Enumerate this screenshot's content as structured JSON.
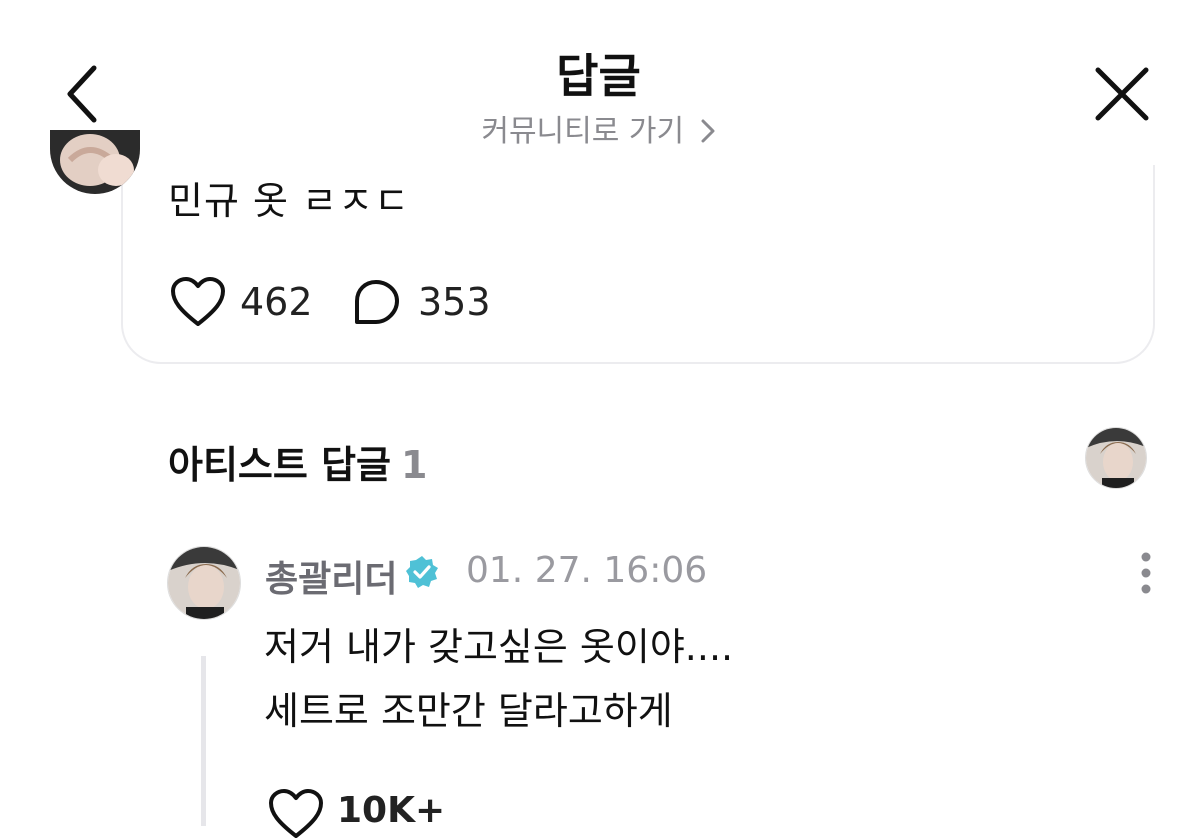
{
  "header": {
    "title": "답글",
    "community_link": "커뮤니티로 가기"
  },
  "post": {
    "text": "민규 옷 ㄹㅈㄷ",
    "likes": "462",
    "comments": "353"
  },
  "artist_replies": {
    "title": "아티스트 답글",
    "count": "1"
  },
  "reply": {
    "author": "총괄리더",
    "timestamp": "01. 27. 16:06",
    "line1": "저거 내가 갖고싶은 옷이야....",
    "line2": "세트로 조만간 달라고하게",
    "likes": "10K+"
  },
  "colors": {
    "verified": "#4fc1d6",
    "meta_gray": "#9a9aa0",
    "border": "#ececef"
  }
}
